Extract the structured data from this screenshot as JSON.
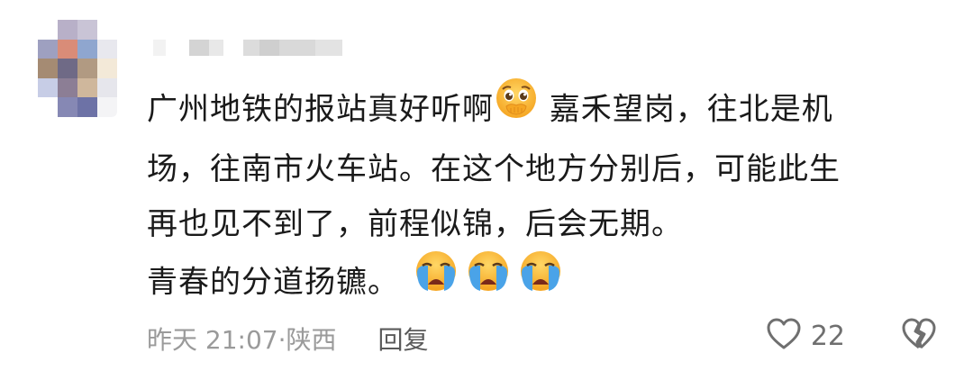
{
  "comment": {
    "text_lines": [
      {
        "before": "广州地铁的报站真好听啊",
        "emoji": "pleading-face-emoji",
        "after": " 嘉禾望岗，往北是机"
      },
      {
        "before": "场，往南市火车站。在这个地方分别后，可能此生"
      },
      {
        "before": "再也见不到了，前程似锦，后会无期。"
      },
      {
        "before": "青春的分道扬镳。",
        "emojis": [
          "loudly-crying-face-emoji",
          "loudly-crying-face-emoji",
          "loudly-crying-face-emoji"
        ]
      }
    ],
    "time_location": "昨天 21:07·陕西",
    "reply_label": "回复",
    "like_count": "22"
  },
  "colors": {
    "text": "#1a1a1a",
    "meta": "#9a9a9a",
    "icon": "#6f6f6f"
  },
  "icons": {
    "like": "heart-outline-icon",
    "dislike": "broken-heart-icon"
  }
}
